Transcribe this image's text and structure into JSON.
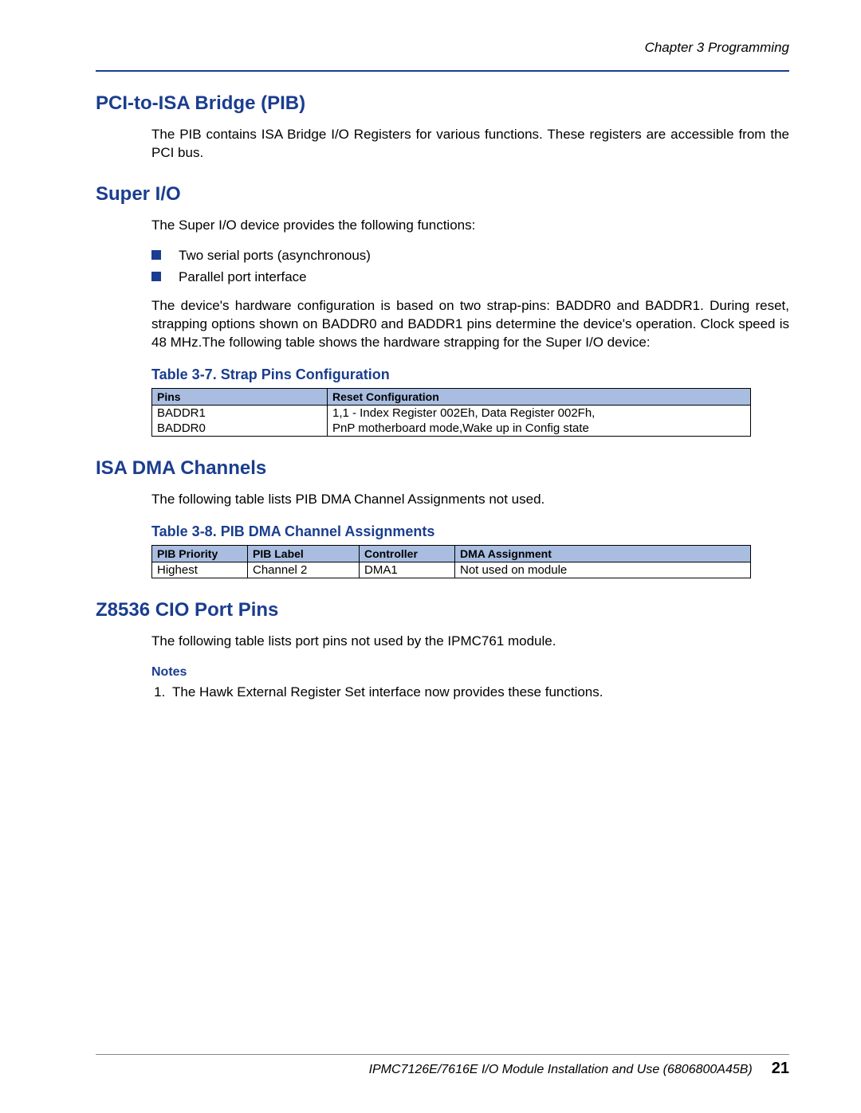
{
  "header": {
    "chapter_ref": "Chapter 3  Programming"
  },
  "sections": {
    "pib": {
      "heading": "PCI-to-ISA Bridge (PIB)",
      "para1": "The PIB contains ISA Bridge I/O Registers for various functions. These registers are accessible from the PCI bus."
    },
    "superio": {
      "heading": "Super I/O",
      "para1": "The Super I/O device provides the following functions:",
      "bullets": [
        "Two serial ports (asynchronous)",
        "Parallel port interface"
      ],
      "para2": "The device's hardware configuration is based on two strap-pins: BADDR0 and BADDR1. During reset, strapping options shown on BADDR0 and BADDR1 pins determine the device's operation. Clock speed is 48 MHz.The following table shows the hardware strapping for the Super I/O device:",
      "table_caption": "Table 3-7. Strap Pins Configuration",
      "table": {
        "headers": [
          "Pins",
          "Reset Configuration"
        ],
        "rows": [
          [
            "BADDR1",
            "1,1 - Index Register 002Eh, Data Register 002Fh,"
          ],
          [
            "BADDR0",
            "PnP motherboard mode,Wake up in Config state"
          ]
        ]
      }
    },
    "isa_dma": {
      "heading": "ISA DMA Channels",
      "para1": "The following table lists PIB DMA Channel Assignments not used.",
      "table_caption": "Table 3-8. PIB DMA Channel Assignments",
      "table": {
        "headers": [
          "PIB Priority",
          "PIB Label",
          "Controller",
          "DMA Assignment"
        ],
        "rows": [
          [
            "Highest",
            "Channel 2",
            "DMA1",
            "Not used on module"
          ]
        ]
      }
    },
    "z8536": {
      "heading": "Z8536 CIO Port Pins",
      "para1": "The following table lists port pins not used by the IPMC761 module.",
      "notes_heading": "Notes",
      "notes": [
        "The Hawk External Register Set interface now provides these functions."
      ]
    }
  },
  "footer": {
    "doc_title": "IPMC7126E/7616E I/O Module Installation and Use (6806800A45B)",
    "page_num": "21"
  }
}
